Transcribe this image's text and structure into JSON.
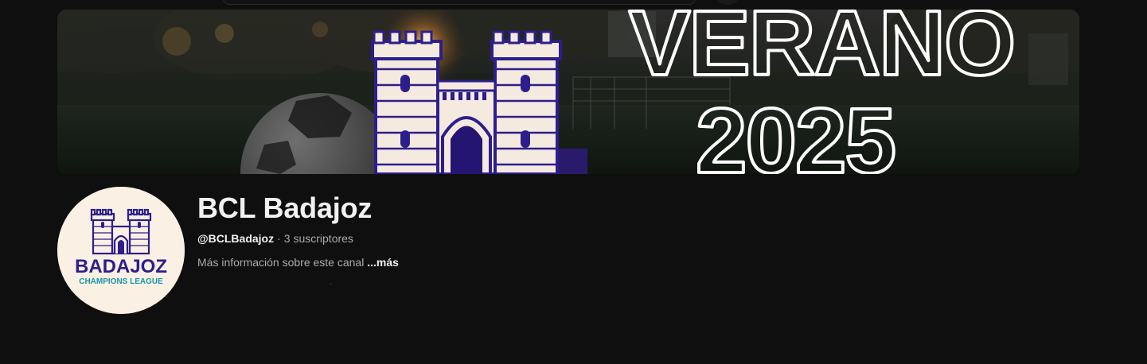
{
  "banner": {
    "line1": "VERANO",
    "line2": "2025"
  },
  "avatar": {
    "logo_text": "BADAJOZ",
    "logo_subtext": "CHAMPIONS LEAGUE"
  },
  "channel": {
    "name": "BCL Badajoz",
    "handle": "@BCLBadajoz",
    "separator": "·",
    "subscribers": "3 suscriptores",
    "description": "Más información sobre este canal",
    "more_label": "...más"
  }
}
